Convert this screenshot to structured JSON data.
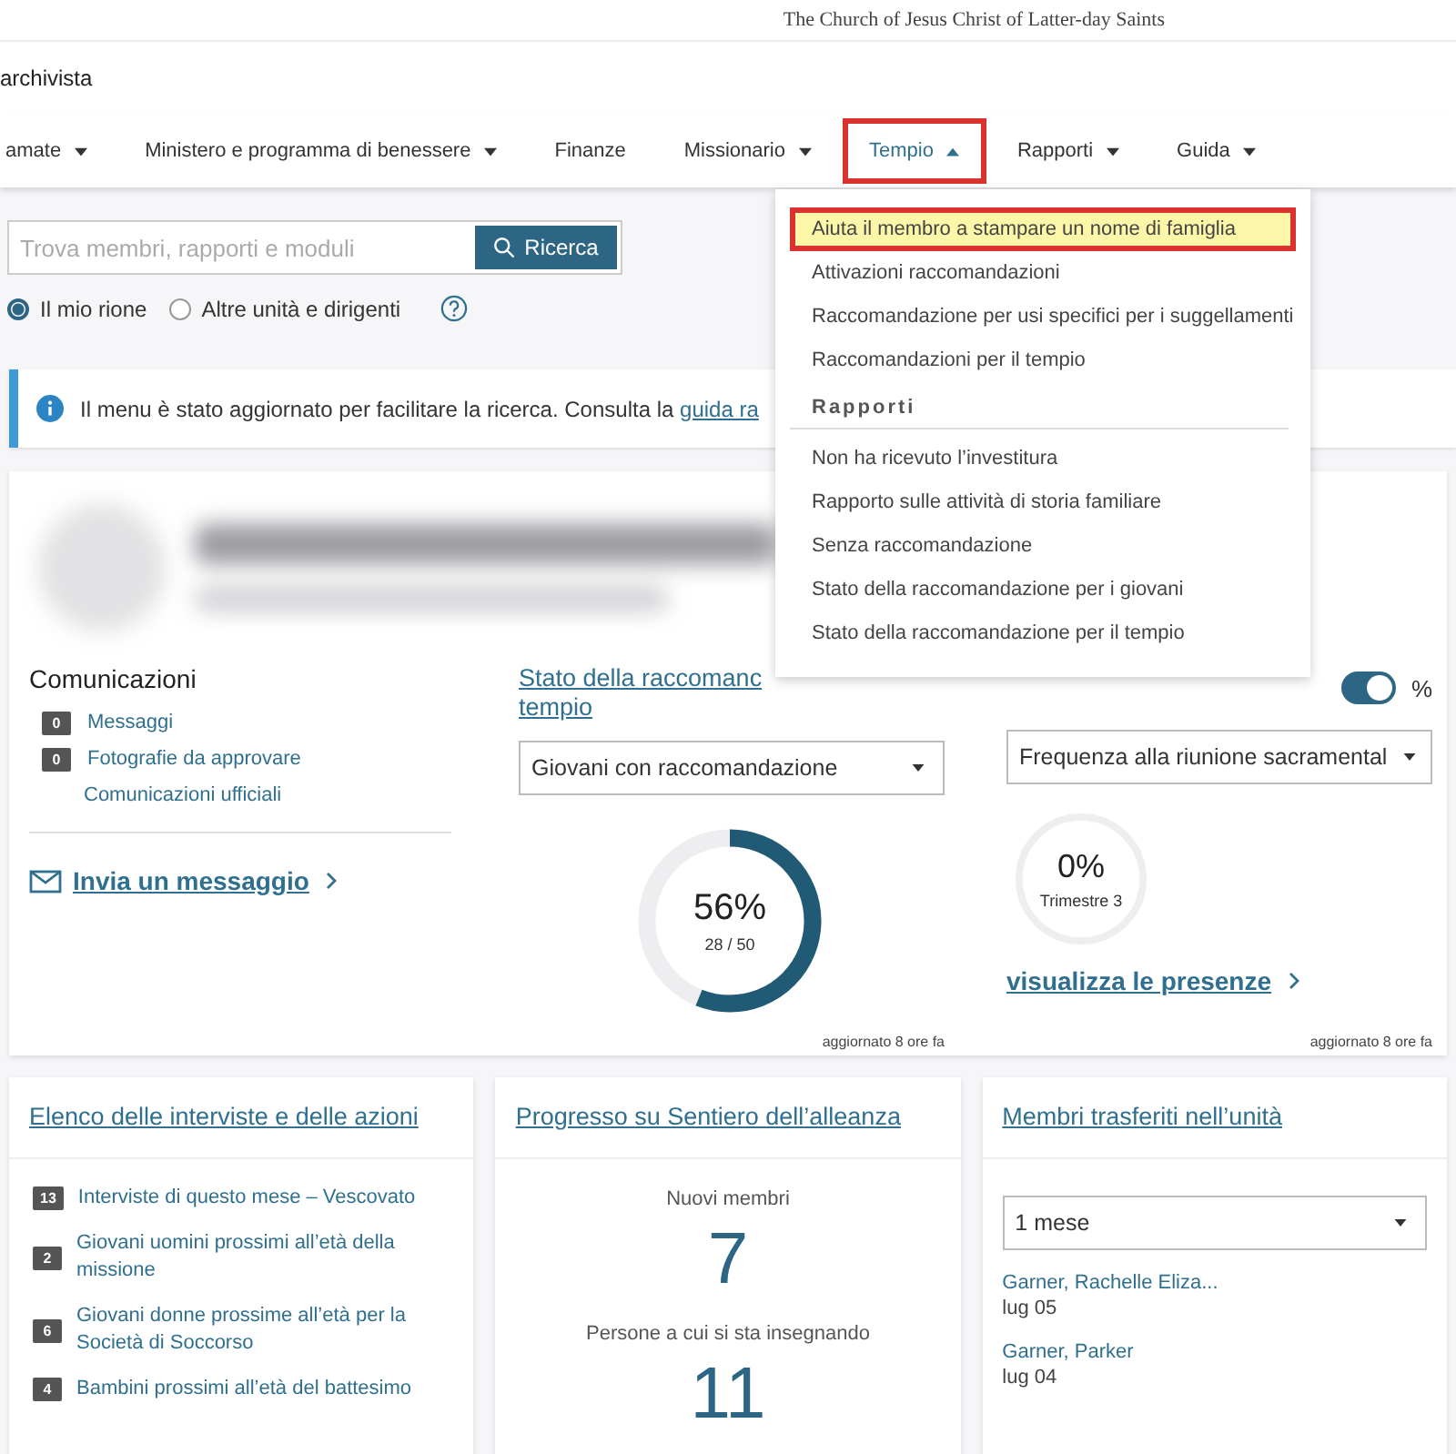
{
  "header": {
    "org_name": "The Church of Jesus Christ of Latter-day Saints",
    "app_title": "archivista"
  },
  "nav": [
    {
      "label": "amate",
      "caret": true,
      "expanded": false,
      "highlighted": false
    },
    {
      "label": "Ministero e programma di benessere",
      "caret": true,
      "expanded": false,
      "highlighted": false
    },
    {
      "label": "Finanze",
      "caret": false,
      "expanded": false,
      "highlighted": false
    },
    {
      "label": "Missionario",
      "caret": true,
      "expanded": false,
      "highlighted": false
    },
    {
      "label": "Tempio",
      "caret": true,
      "expanded": true,
      "highlighted": true
    },
    {
      "label": "Rapporti",
      "caret": true,
      "expanded": false,
      "highlighted": false
    },
    {
      "label": "Guida",
      "caret": true,
      "expanded": false,
      "highlighted": false
    }
  ],
  "nav_menu": [
    {
      "kind": "item",
      "label": "Aiuta il membro a stampare un nome di famiglia",
      "highlighted": true
    },
    {
      "kind": "item",
      "label": "Attivazioni raccomandazioni",
      "highlighted": false
    },
    {
      "kind": "item",
      "label": "Raccomandazione per usi specifici per i suggellamenti",
      "highlighted": false
    },
    {
      "kind": "item",
      "label": "Raccomandazioni per il tempio",
      "highlighted": false
    },
    {
      "kind": "heading",
      "label": "Rapporti"
    },
    {
      "kind": "item",
      "label": "Non ha ricevuto l’investitura",
      "highlighted": false
    },
    {
      "kind": "item",
      "label": "Rapporto sulle attività di storia familiare",
      "highlighted": false
    },
    {
      "kind": "item",
      "label": "Senza raccomandazione",
      "highlighted": false
    },
    {
      "kind": "item",
      "label": "Stato della raccomandazione per i giovani",
      "highlighted": false
    },
    {
      "kind": "item",
      "label": "Stato della raccomandazione per il tempio",
      "highlighted": false
    }
  ],
  "search": {
    "placeholder": "Trova membri, rapporti e moduli",
    "button": "Ricerca"
  },
  "scope": [
    {
      "label": "Il mio rione",
      "selected": true
    },
    {
      "label": "Altre unità e dirigenti",
      "selected": false
    }
  ],
  "notice": {
    "text": "Il menu è stato aggiornato per facilitare la ricerca. Consulta la",
    "link": "guida ra"
  },
  "communications": {
    "title": "Comunicazioni",
    "items": [
      {
        "count": "0",
        "label": "Messaggi"
      },
      {
        "count": "0",
        "label": "Fotografie da approvare"
      },
      {
        "label": "Comunicazioni ufficiali"
      }
    ],
    "send_link": "Invia un messaggio"
  },
  "recommend": {
    "title_lines": [
      "Stato della raccomanc",
      "tempio"
    ],
    "select": "Giovani con raccomandazione",
    "percent": "56%",
    "ratio": "28 / 50",
    "level": 0.56,
    "updated": "aggiornato 8 ore fa"
  },
  "attendance": {
    "toggle_on": true,
    "toggle_label": "%",
    "select": "Frequenza alla riunione sacramental",
    "percent": "0%",
    "period": "Trimestre 3",
    "level": 0,
    "link": "visualizza le presenze",
    "updated": "aggiornato 8 ore fa"
  },
  "cards": [
    {
      "kind": "list",
      "title": "Elenco delle interviste e delle azioni",
      "items": [
        {
          "count": "13",
          "label": "Interviste di questo mese – Vescovato"
        },
        {
          "count": "2",
          "label": "Giovani uomini prossimi all’età della missione"
        },
        {
          "count": "6",
          "label": "Giovani donne prossime all’età per la Società di Soccorso"
        },
        {
          "count": "4",
          "label": "Bambini prossimi all’età del battesimo"
        }
      ]
    },
    {
      "kind": "stats",
      "title": "Progresso su Sentiero dell’alleanza",
      "stats": [
        {
          "label": "Nuovi membri",
          "value": "7"
        },
        {
          "label": "Persone a cui si sta insegnando",
          "value": "11"
        }
      ]
    },
    {
      "kind": "members",
      "title": "Membri trasferiti nell’unità",
      "select": "1 mese",
      "members": [
        {
          "name": "Garner, Rachelle Eliza...",
          "date": "lug 05"
        },
        {
          "name": "Garner, Parker",
          "date": "lug 04"
        }
      ]
    }
  ]
}
